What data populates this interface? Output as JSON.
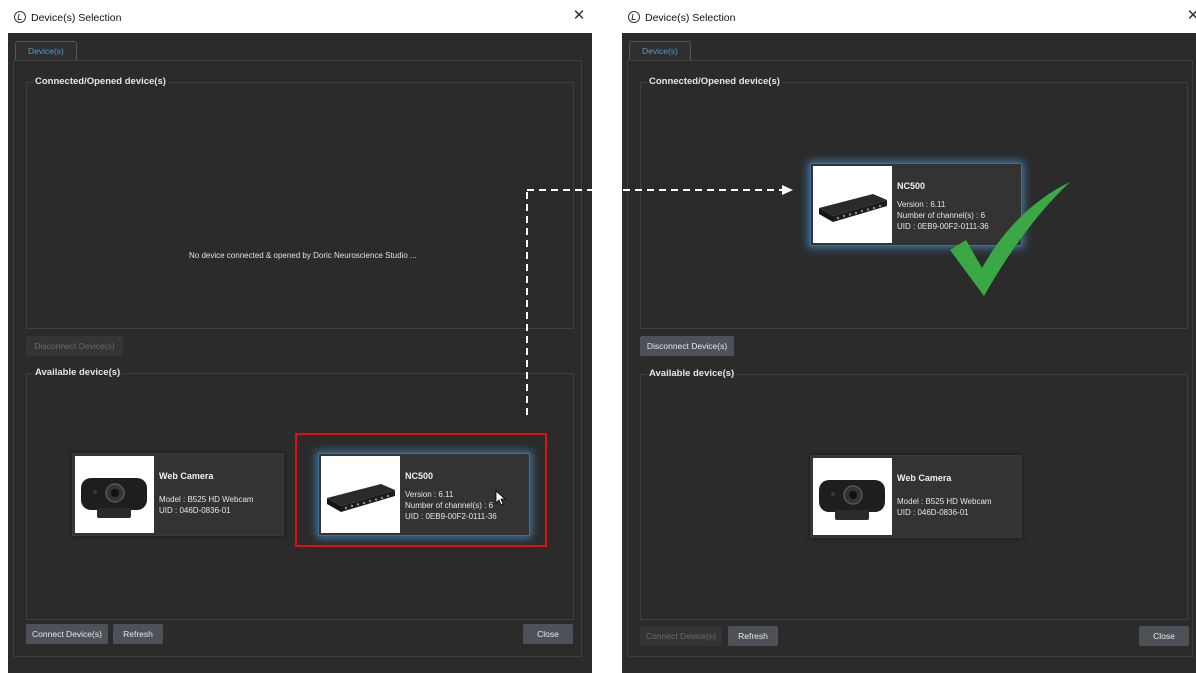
{
  "left": {
    "title": "Device(s) Selection",
    "tab": "Device(s)",
    "connected_group": "Connected/Opened device(s)",
    "empty_message": "No device connected & opened by Doric Neuroscience Studio ...",
    "disconnect_button": "Disconnect Device(s)",
    "available_group": "Available device(s)",
    "devices": [
      {
        "name": "Web Camera",
        "line1": "Model : B525 HD Webcam",
        "line2": "UID : 046D-0836-01"
      },
      {
        "name": "NC500",
        "line1": "Version : 6.11",
        "line2": "Number of channel(s) : 6",
        "line3": "UID : 0EB9-00F2-0111-36"
      }
    ],
    "connect_button": "Connect Device(s)",
    "refresh_button": "Refresh",
    "close_button": "Close"
  },
  "right": {
    "title": "Device(s) Selection",
    "tab": "Device(s)",
    "connected_group": "Connected/Opened device(s)",
    "connected_device": {
      "name": "NC500",
      "line1": "Version : 6.11",
      "line2": "Number of channel(s) : 6",
      "line3": "UID : 0EB9-00F2-0111-36"
    },
    "disconnect_button": "Disconnect Device(s)",
    "available_group": "Available device(s)",
    "available_device": {
      "name": "Web Camera",
      "line1": "Model : B525 HD Webcam",
      "line2": "UID : 046D-0836-01"
    },
    "connect_button": "Connect Device(s)",
    "refresh_button": "Refresh",
    "close_button": "Close"
  },
  "icons": [
    "app-icon",
    "close-icon",
    "webcam-icon",
    "nc500-device-icon",
    "mouse-cursor-icon",
    "checkmark-icon",
    "arrow-icon"
  ],
  "colors": {
    "highlight": "#e01010",
    "checkmark": "#3aa845",
    "tab_text": "#4d9cd6",
    "selection_glow": "#4896d2"
  }
}
